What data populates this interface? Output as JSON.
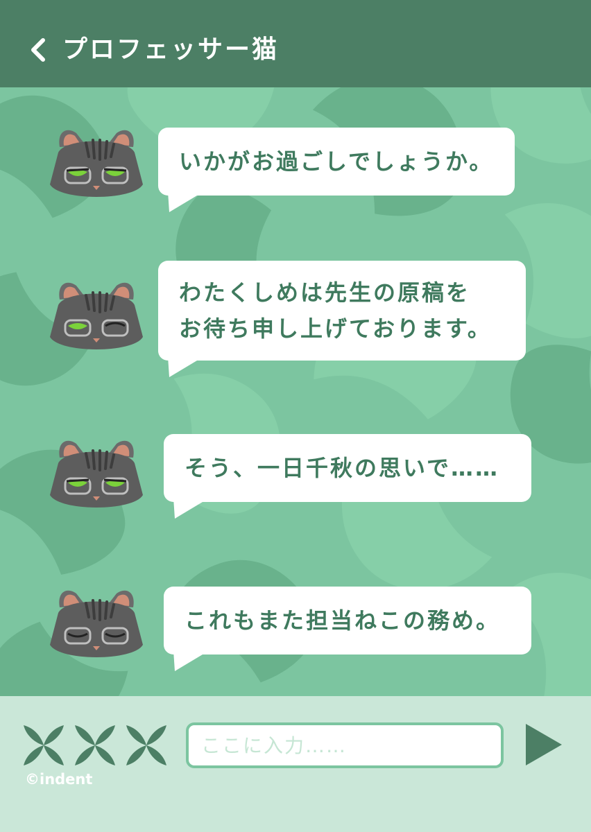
{
  "header": {
    "title": "プロフェッサー猫",
    "back_icon": "chevron-left-icon"
  },
  "colors": {
    "header_bg": "#4c7f65",
    "chat_bg": "#7cc5a0",
    "leaf_dark": "#63ad88",
    "leaf_light": "#8fd4ae",
    "bubble_text": "#3f7a5e",
    "footer_bg": "#cae7d8",
    "send_button": "#4c7f65"
  },
  "messages": [
    {
      "sender": "プロフェッサー猫",
      "expression": "half-open",
      "lines": [
        "いかがお過ごしでしょうか。"
      ]
    },
    {
      "sender": "プロフェッサー猫",
      "expression": "wink",
      "lines": [
        "わたくしめは先生の原稿を",
        "お待ち申し上げております。"
      ]
    },
    {
      "sender": "プロフェッサー猫",
      "expression": "half-open",
      "lines": [
        "そう、一日千秋の思いで……"
      ]
    },
    {
      "sender": "プロフェッサー猫",
      "expression": "closed",
      "lines": [
        "これもまた担当ねこの務め。"
      ]
    }
  ],
  "footer": {
    "stamp_icons": [
      "leaf-clover-icon",
      "leaf-clover-icon",
      "leaf-clover-icon"
    ],
    "input_placeholder": "ここに入力……",
    "input_value": "",
    "send_icon": "send-triangle-icon",
    "copyright": "©indent"
  }
}
